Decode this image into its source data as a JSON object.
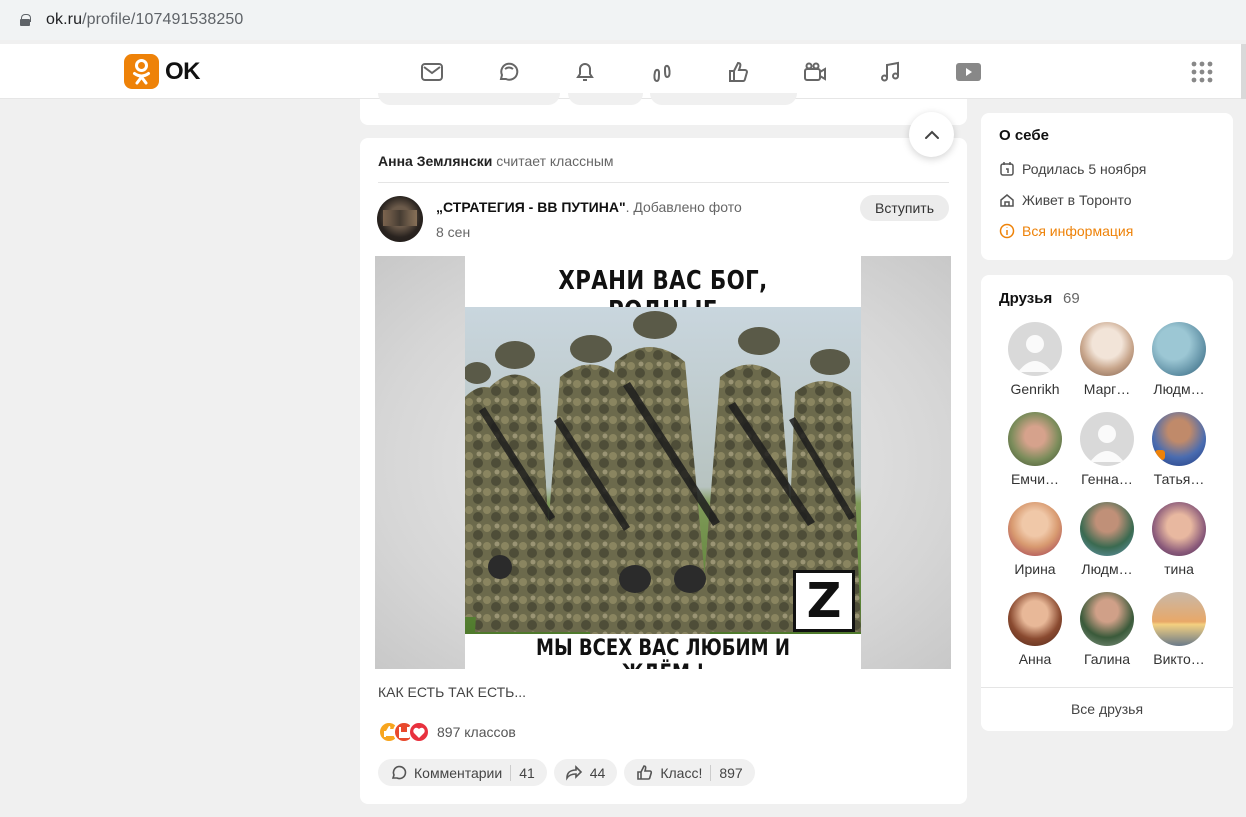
{
  "browser": {
    "url_host": "ok.ru",
    "url_path": "/profile/107491538250"
  },
  "nav": {
    "logo_text": "OK",
    "brand_color": "#ee8208",
    "icons": [
      "mail-icon",
      "chat-icon",
      "bell-icon",
      "guests-icon",
      "like-icon",
      "video-camera-icon",
      "music-icon",
      "video-play-icon"
    ]
  },
  "feed_item": {
    "actor": "Анна Землянски",
    "action": "считает классным",
    "group_name": "„СТРАТЕГИЯ - ВВ ПУТИНА\"",
    "group_action": ". Добавлено фото",
    "date": "8 сен",
    "join_label": "Вступить",
    "poster_top": "ХРАНИ ВАС БОГ, РОДНЫЕ",
    "poster_bottom": "МЫ ВСЕХ ВАС ЛЮБИМ И ЖДЁМ !",
    "poster_badge": "Z",
    "caption": "КАК ЕСТЬ ТАК ЕСТЬ...",
    "reactions_label": "897 классов",
    "comments_label": "Комментарии",
    "comments_count": "41",
    "shares_count": "44",
    "class_label": "Класс!",
    "class_count": "897"
  },
  "about": {
    "title": "О себе",
    "birthday": "Родилась 5 ноября",
    "lives": "Живет в Торонто",
    "all_info": "Вся информация"
  },
  "friends": {
    "title": "Друзья",
    "count": "69",
    "items": [
      {
        "name": "Genrikh"
      },
      {
        "name": "Марг…"
      },
      {
        "name": "Людм…"
      },
      {
        "name": "Емчи…"
      },
      {
        "name": "Генна…"
      },
      {
        "name": "Татья…"
      },
      {
        "name": "Ирина"
      },
      {
        "name": "Людм…"
      },
      {
        "name": "тина"
      },
      {
        "name": "Анна"
      },
      {
        "name": "Галина"
      },
      {
        "name": "Викто…"
      }
    ],
    "all_label": "Все друзья"
  }
}
